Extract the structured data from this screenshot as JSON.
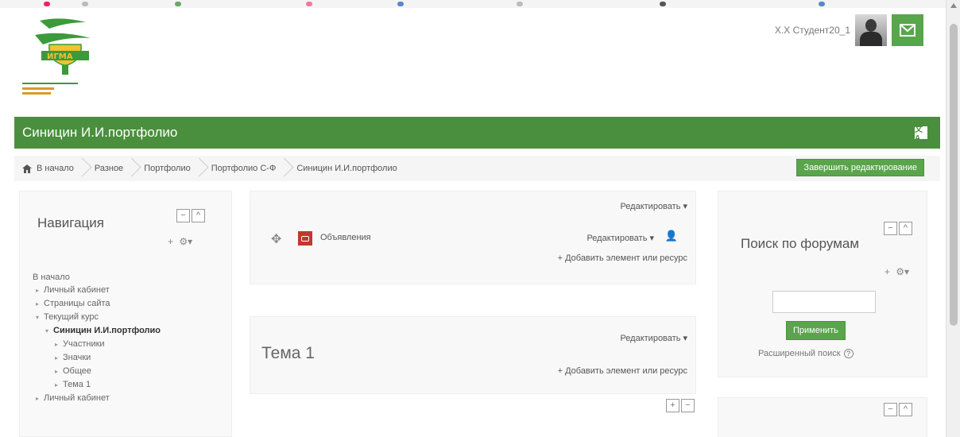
{
  "header": {
    "user_name": "X.X Студент20_1",
    "course_title": "Синицин И.И.портфолио"
  },
  "icons": {
    "home": "home-icon",
    "messages": "envelope-icon",
    "header": "language-icon",
    "avatar": "user-avatar",
    "gear": "gear-icon",
    "move": "move-cross-icon",
    "person": "person-icon",
    "forum": "forum-icon",
    "help": "help-icon"
  },
  "breadcrumb": [
    "В начало",
    "Разное",
    "Портфолио",
    "Портфолио С-Ф",
    "Синицин И.И.портфолио"
  ],
  "buttons": {
    "finish_editing": "Завершить редактирование",
    "apply": "Применить"
  },
  "navigation": {
    "title": "Навигация",
    "tool_plus": "+",
    "tool_gear": "⚙▾",
    "items": [
      {
        "label": "В начало",
        "level": 0,
        "arrow": "",
        "bold": false
      },
      {
        "label": "Личный кабинет",
        "level": 1,
        "arrow": "▸",
        "bold": false
      },
      {
        "label": "Страницы сайта",
        "level": 1,
        "arrow": "▸",
        "bold": false
      },
      {
        "label": "Текущий курс",
        "level": 1,
        "arrow": "▾",
        "bold": false
      },
      {
        "label": "Синицин И.И.портфолио",
        "level": 2,
        "arrow": "▾",
        "bold": true
      },
      {
        "label": "Участники",
        "level": 3,
        "arrow": "▸",
        "bold": false
      },
      {
        "label": "Значки",
        "level": 3,
        "arrow": "▸",
        "bold": false
      },
      {
        "label": "Общее",
        "level": 3,
        "arrow": "▸",
        "bold": false
      },
      {
        "label": "Тема 1",
        "level": 3,
        "arrow": "▸",
        "bold": false
      },
      {
        "label": "Личный кабинет",
        "level": 1,
        "arrow": "▸",
        "bold": false
      }
    ]
  },
  "sections": {
    "general": {
      "edit_label": "Редактировать ▾",
      "activity_name": "Объявления",
      "activity_edit": "Редактировать ▾",
      "add_label": "+ Добавить элемент или ресурс"
    },
    "topic1": {
      "edit_label": "Редактировать ▾",
      "title": "Тема 1",
      "add_label": "+ Добавить элемент или ресурс"
    },
    "controls": [
      "+",
      "−"
    ]
  },
  "forum_search": {
    "title": "Поиск по форумам",
    "input_value": "",
    "advanced": "Расширенный поиск"
  },
  "block_controls": [
    "−",
    "^"
  ],
  "colors": {
    "brand_green": "#4a8f3d",
    "button_green": "#5aa54c",
    "forum_icon_red": "#c0392b"
  }
}
